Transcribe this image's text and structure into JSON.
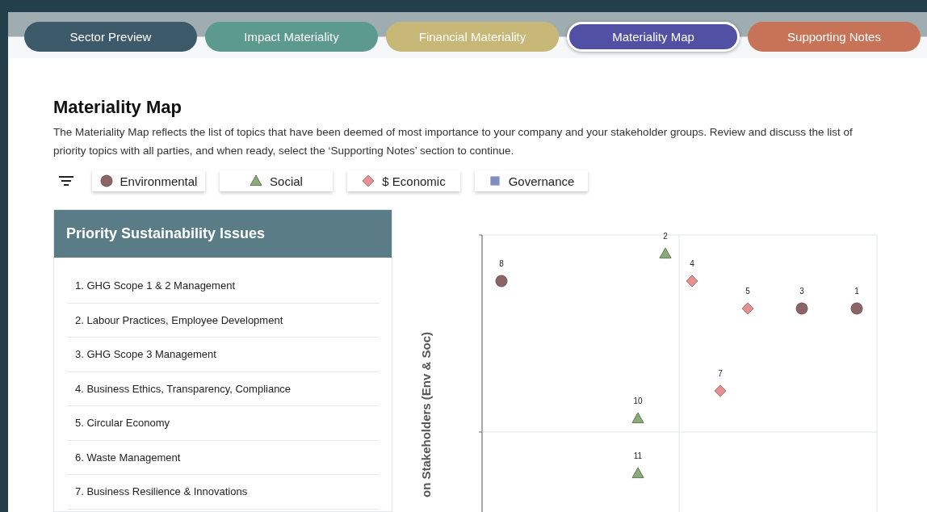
{
  "tabs": [
    {
      "label": "Sector Preview",
      "color": "#3d5a6b",
      "selected": false
    },
    {
      "label": "Impact Materiality",
      "color": "#5b9a8c",
      "selected": false
    },
    {
      "label": "Financial Materiality",
      "color": "#c7b877",
      "selected": false
    },
    {
      "label": "Materiality Map",
      "color": "#5150a5",
      "selected": true
    },
    {
      "label": "Supporting Notes",
      "color": "#c87357",
      "selected": false
    }
  ],
  "heading": "Materiality Map",
  "description": "The Materiality Map reflects the list of topics that have been deemed of most importance to your company and your stakeholder groups. Review and discuss the list of priority topics with all parties, and when ready, select the ‘Supporting Notes’ section to continue.",
  "legend": [
    {
      "kind": "environmental",
      "label": "Environmental"
    },
    {
      "kind": "social",
      "label": "Social"
    },
    {
      "kind": "economic",
      "label": "$ Economic"
    },
    {
      "kind": "governance",
      "label": "Governance"
    }
  ],
  "issues_panel": {
    "title": "Priority Sustainability Issues",
    "items": [
      "1. GHG Scope 1 & 2 Management",
      "2. Labour Practices, Employee Development",
      "3. GHG Scope 3 Management",
      "4. Business Ethics, Transparency, Compliance",
      "5. Circular Economy",
      "6. Waste Management",
      "7. Business Resilience & Innovations"
    ]
  },
  "chart": {
    "ylabel": "on Stakeholders (Env & Soc)",
    "points": [
      {
        "label": "8",
        "kind": "environmental"
      },
      {
        "label": "2",
        "kind": "social"
      },
      {
        "label": "4",
        "kind": "economic"
      },
      {
        "label": "5",
        "kind": "economic"
      },
      {
        "label": "3",
        "kind": "environmental"
      },
      {
        "label": "1",
        "kind": "environmental"
      },
      {
        "label": "7",
        "kind": "economic"
      },
      {
        "label": "10",
        "kind": "social"
      },
      {
        "label": "11",
        "kind": "social"
      }
    ]
  }
}
